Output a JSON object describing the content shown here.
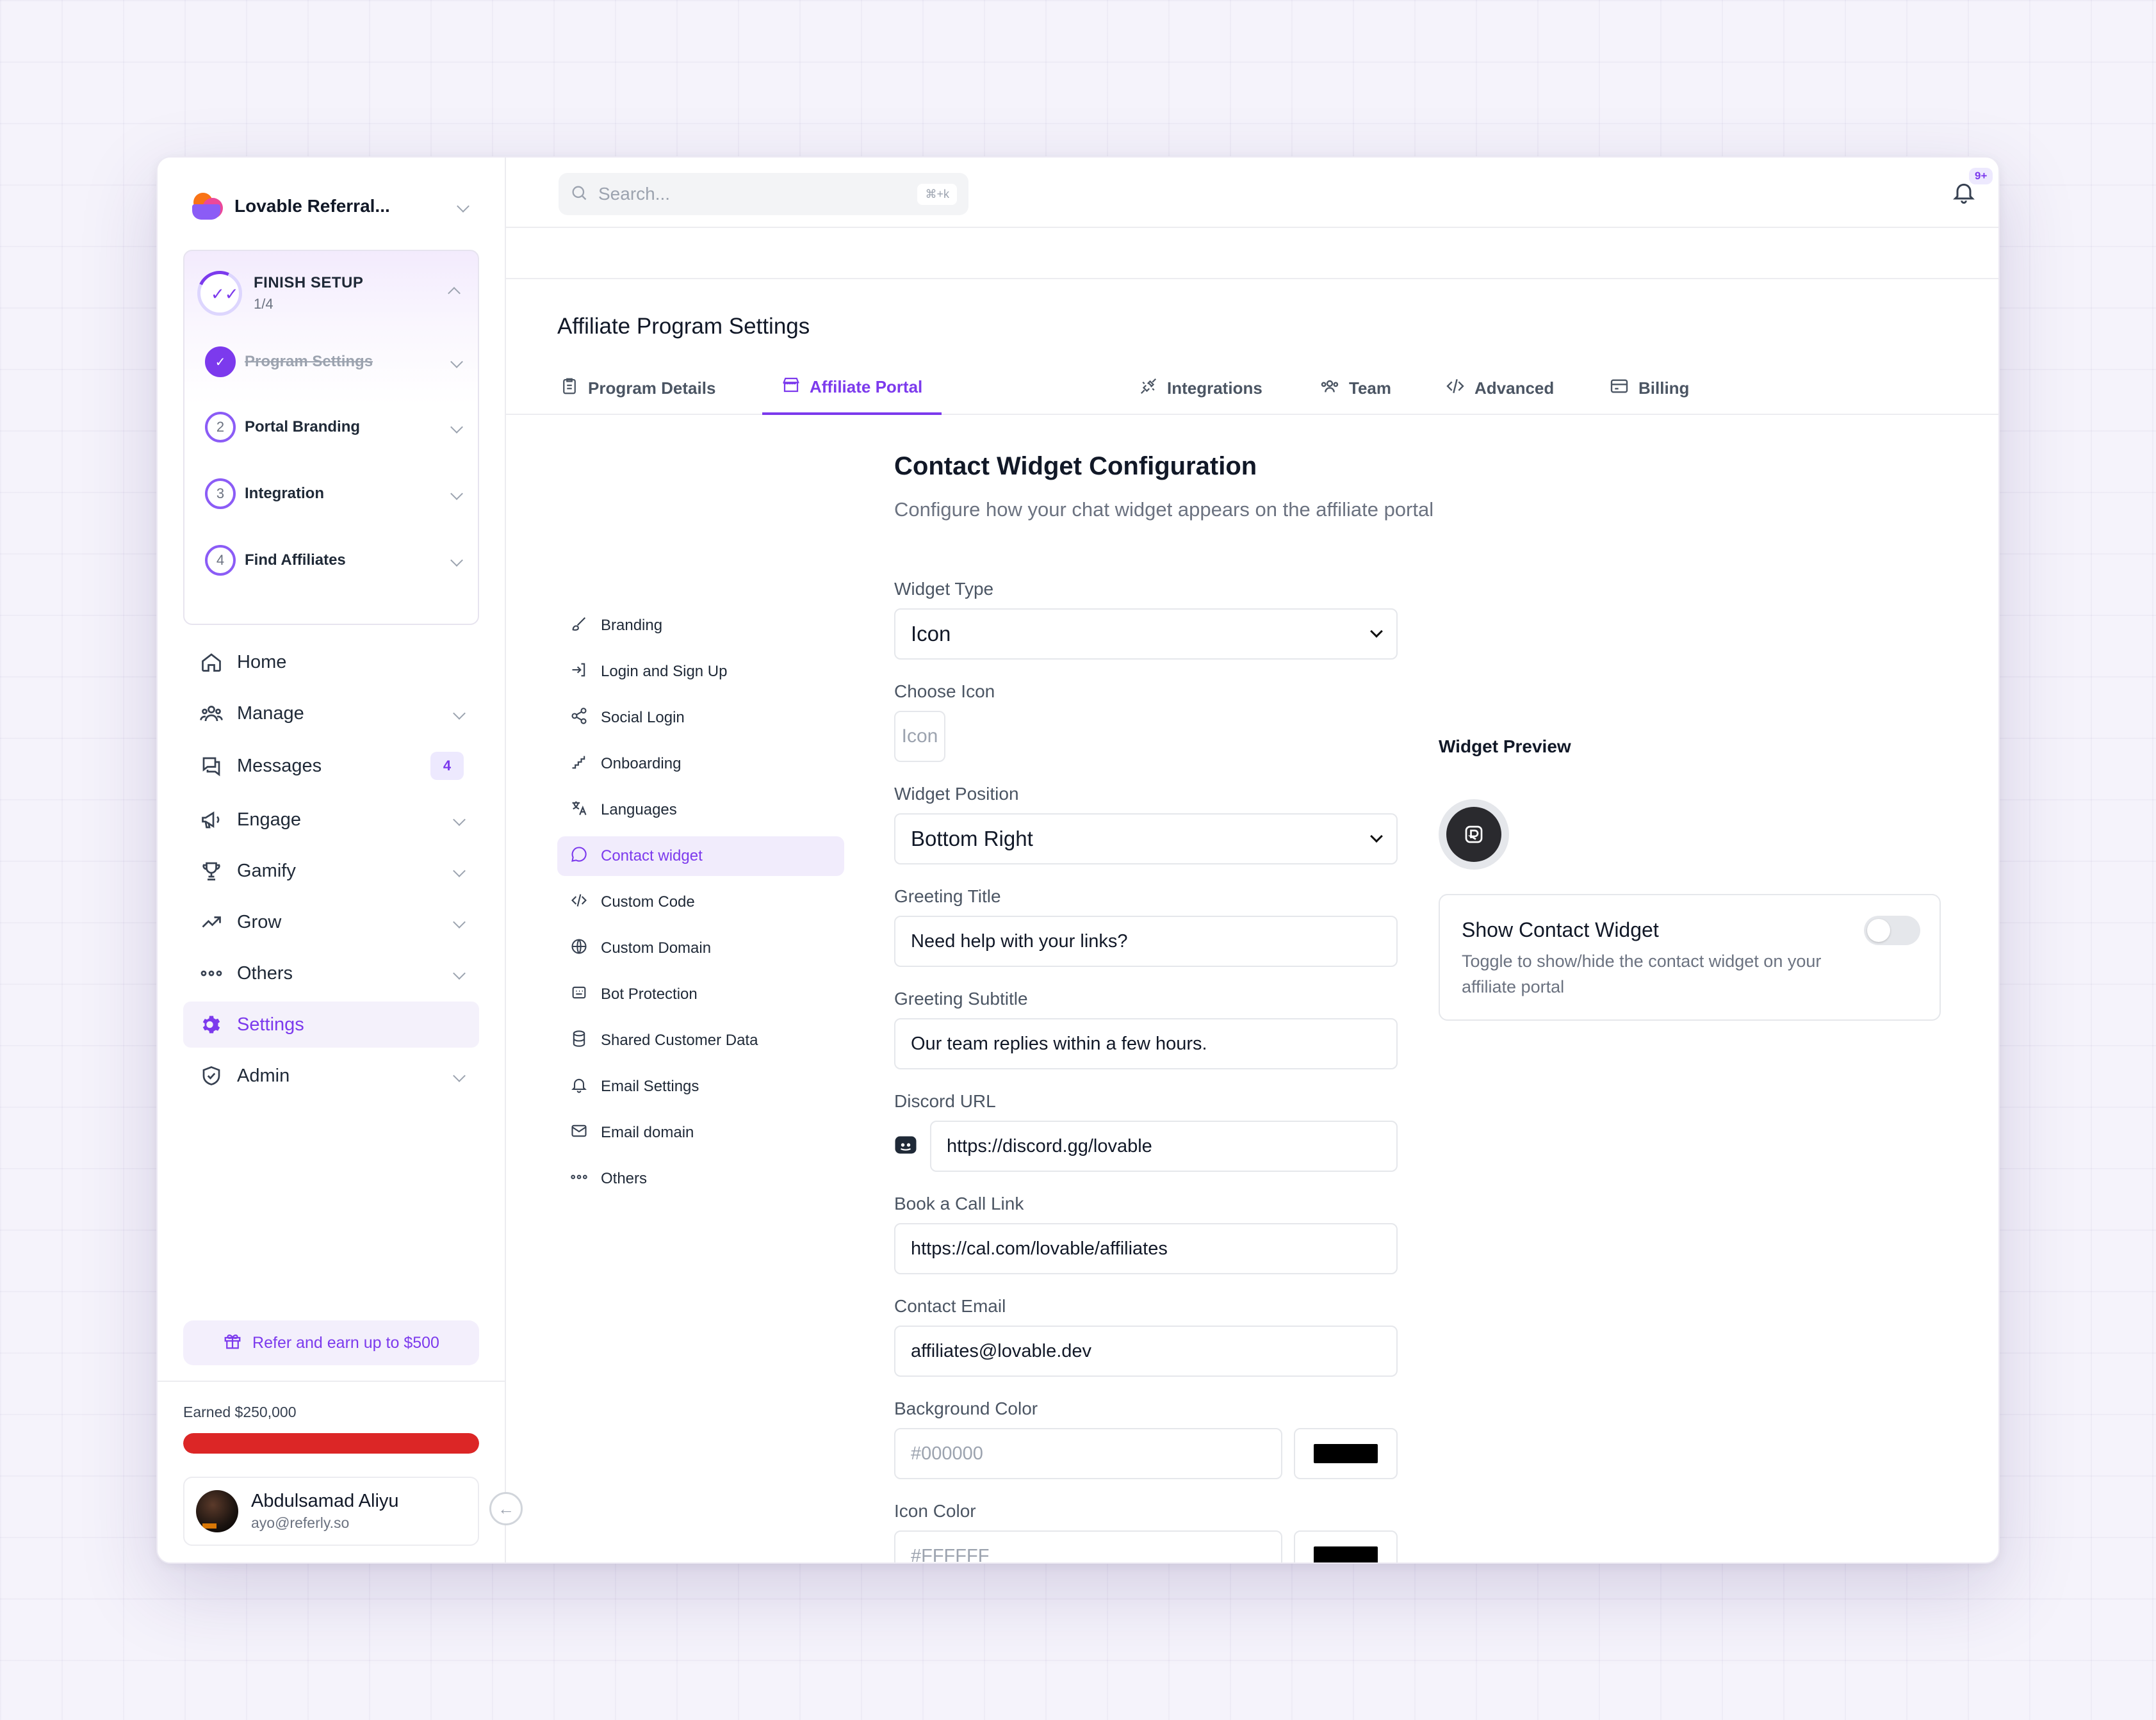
{
  "workspace": {
    "name": "Lovable Referral..."
  },
  "setup": {
    "title": "FINISH SETUP",
    "progress": "1/4",
    "steps": [
      {
        "num": "",
        "label": "Program Settings",
        "done": true
      },
      {
        "num": "2",
        "label": "Portal Branding",
        "done": false
      },
      {
        "num": "3",
        "label": "Integration",
        "done": false
      },
      {
        "num": "4",
        "label": "Find Affiliates",
        "done": false
      }
    ]
  },
  "nav": {
    "home": "Home",
    "manage": "Manage",
    "messages": "Messages",
    "messages_badge": "4",
    "engage": "Engage",
    "gamify": "Gamify",
    "grow": "Grow",
    "others": "Others",
    "settings": "Settings",
    "admin": "Admin"
  },
  "refer": {
    "label": "Refer and earn up to $500"
  },
  "earnings": {
    "label": "Earned $250,000",
    "progress": 1.0
  },
  "user": {
    "name": "Abdulsamad Aliyu",
    "email": "ayo@referly.so"
  },
  "topbar": {
    "search_placeholder": "Search...",
    "search_shortcut": "⌘+k",
    "notification_count": "9+"
  },
  "page": {
    "title": "Affiliate Program Settings",
    "tabs": [
      {
        "label": "Program Details"
      },
      {
        "label": "Affiliate Portal"
      },
      {
        "label": "Integrations"
      },
      {
        "label": "Team"
      },
      {
        "label": "Advanced"
      },
      {
        "label": "Billing"
      }
    ],
    "active_tab": "Affiliate Portal"
  },
  "subnav": [
    {
      "label": "Branding"
    },
    {
      "label": "Login and Sign Up"
    },
    {
      "label": "Social Login"
    },
    {
      "label": "Onboarding"
    },
    {
      "label": "Languages"
    },
    {
      "label": "Contact widget"
    },
    {
      "label": "Custom Code"
    },
    {
      "label": "Custom Domain"
    },
    {
      "label": "Bot Protection"
    },
    {
      "label": "Shared Customer Data"
    },
    {
      "label": "Email Settings"
    },
    {
      "label": "Email domain"
    },
    {
      "label": "Others"
    }
  ],
  "form": {
    "title": "Contact Widget Configuration",
    "description": "Configure how your chat widget appears on the affiliate portal",
    "widget_type": {
      "label": "Widget Type",
      "value": "Icon"
    },
    "choose_icon": {
      "label": "Choose Icon",
      "value": "Icon"
    },
    "widget_position": {
      "label": "Widget Position",
      "value": "Bottom Right"
    },
    "greeting_title": {
      "label": "Greeting Title",
      "value": "Need help with your links?"
    },
    "greeting_subtitle": {
      "label": "Greeting Subtitle",
      "value": "Our team replies within a few hours."
    },
    "discord_url": {
      "label": "Discord URL",
      "value": "https://discord.gg/lovable"
    },
    "book_call": {
      "label": "Book a Call Link",
      "value": "https://cal.com/lovable/affiliates"
    },
    "contact_email": {
      "label": "Contact Email",
      "value": "affiliates@lovable.dev"
    },
    "background_color": {
      "label": "Background Color",
      "placeholder": "#000000",
      "swatch": "#000000"
    },
    "icon_color": {
      "label": "Icon Color",
      "placeholder": "#FFFFFF",
      "swatch": "#000000"
    }
  },
  "preview": {
    "label": "Widget Preview",
    "show_title": "Show Contact Widget",
    "show_desc": "Toggle to show/hide the contact widget on your affiliate portal",
    "enabled": false
  },
  "colors": {
    "accent": "#7c3aed",
    "progress": "#dc2626"
  }
}
